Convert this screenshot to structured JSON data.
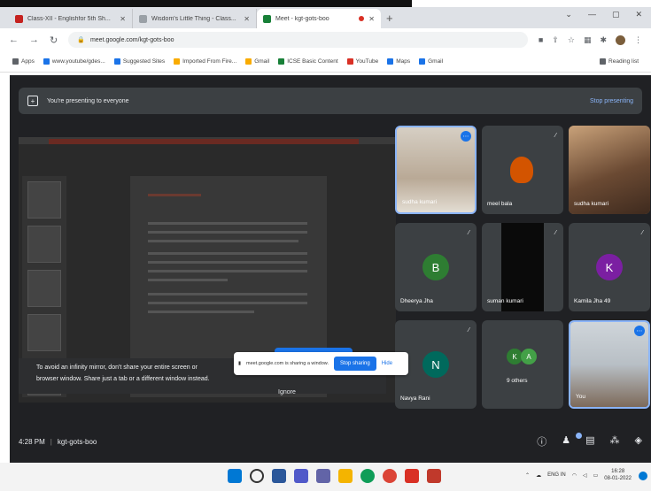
{
  "browser": {
    "tabs": [
      {
        "label": "Class-XII - Englishfor 5th Sh...",
        "fav_color": "#c5221f",
        "active": false
      },
      {
        "label": "Wisdom's Little Thing - Class...",
        "fav_color": "#9aa0a6",
        "active": false
      },
      {
        "label": "Meet - kgt-gots-boo",
        "fav_color": "#188038",
        "active": true
      }
    ],
    "new_tab": "+",
    "url": "meet.google.com/kgt-gots-boo",
    "bookmarks": [
      {
        "label": "Apps",
        "color": "#5f6368"
      },
      {
        "label": "www.youtube/gdes...",
        "color": "#1a73e8"
      },
      {
        "label": "Suggested Sites",
        "color": "#1a73e8"
      },
      {
        "label": "Imported From Fire...",
        "color": "#f9ab00"
      },
      {
        "label": "Gmail",
        "color": "#f9ab00"
      },
      {
        "label": "ICSE Basic Content",
        "color": "#188038"
      },
      {
        "label": "YouTube",
        "color": "#d93025"
      },
      {
        "label": "Maps",
        "color": "#1a73e8"
      },
      {
        "label": "Gmail",
        "color": "#1a73e8"
      }
    ],
    "reading_list": "Reading list"
  },
  "meet": {
    "banner_text": "You're presenting to everyone",
    "banner_stop": "Stop presenting",
    "mirror_text_line1": "To avoid an infinity mirror, don't share your entire screen or",
    "mirror_text_line2": "browser window. Share just a tab or a different window instead.",
    "mirror_stop_button": "Stop presenting",
    "ignore": "Ignore",
    "participants": [
      {
        "name": "sudha kumari",
        "kind": "video",
        "color": "#c9c0b4",
        "highlight": true
      },
      {
        "name": "meel bala",
        "kind": "video",
        "color": "#3c4043",
        "highlight": false
      },
      {
        "name": "sudha kumari",
        "kind": "video",
        "color": "#8a6a4f",
        "highlight": false
      },
      {
        "name": "Dheerya Jha",
        "kind": "letter",
        "letter": "B",
        "color": "#2e7d32",
        "highlight": false
      },
      {
        "name": "suman kumari",
        "kind": "video",
        "color": "#0a0a0a",
        "highlight": false
      },
      {
        "name": "Kamila Jha 49",
        "kind": "letter",
        "letter": "K",
        "color": "#7b1fa2",
        "highlight": false
      },
      {
        "name": "Navya Rani",
        "kind": "letter",
        "letter": "N",
        "color": "#00695c",
        "highlight": false
      },
      {
        "name": "9 others",
        "kind": "others",
        "color": "#3c4043",
        "highlight": false
      },
      {
        "name": "You",
        "kind": "video",
        "color": "#b8bfc5",
        "highlight": true
      }
    ],
    "time": "4:28 PM",
    "separator": "|",
    "meeting_code": "kgt-gots-boo",
    "share_notice": "meet.google.com is sharing a window.",
    "share_stop": "Stop sharing",
    "share_hide": "Hide"
  },
  "taskbar": {
    "lang": "ENG IN",
    "time": "16:28",
    "date": "08-01-2022"
  }
}
